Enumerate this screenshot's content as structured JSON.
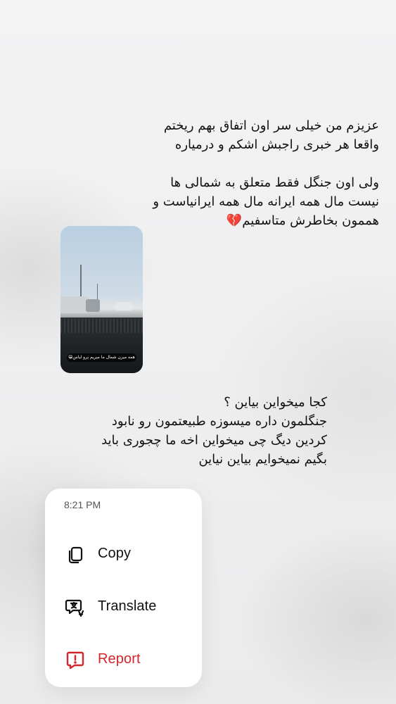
{
  "message_1": {
    "text": "عزیزم من خیلی سر اون اتفاق بهم ریختم\nواقعا هر خبری راجبش اشکم و درمیاره\n\nولی اون جنگل فقط متعلق به شمالی ها\nنیست مال همه ایرانه مال همه ایرانیاست و\nهممون بخاطرش متاسفیم💔"
  },
  "media": {
    "caption": "همه میرن شمال ما میریم پرو لباس😁"
  },
  "message_2": {
    "text": "کجا میخواین بیاین ؟\nجنگلمون داره میسوزه طبیعتمون رو نابود\nکردین دیگ چی میخواین اخه ما چجوری باید\nبگیم نمیخوایم بیاین نیاین"
  },
  "context_menu": {
    "time": "8:21 PM",
    "items": [
      {
        "label": "Copy",
        "icon": "copy-icon"
      },
      {
        "label": "Translate",
        "icon": "translate-icon"
      },
      {
        "label": "Report",
        "icon": "report-icon",
        "color": "#d3262a"
      }
    ]
  }
}
